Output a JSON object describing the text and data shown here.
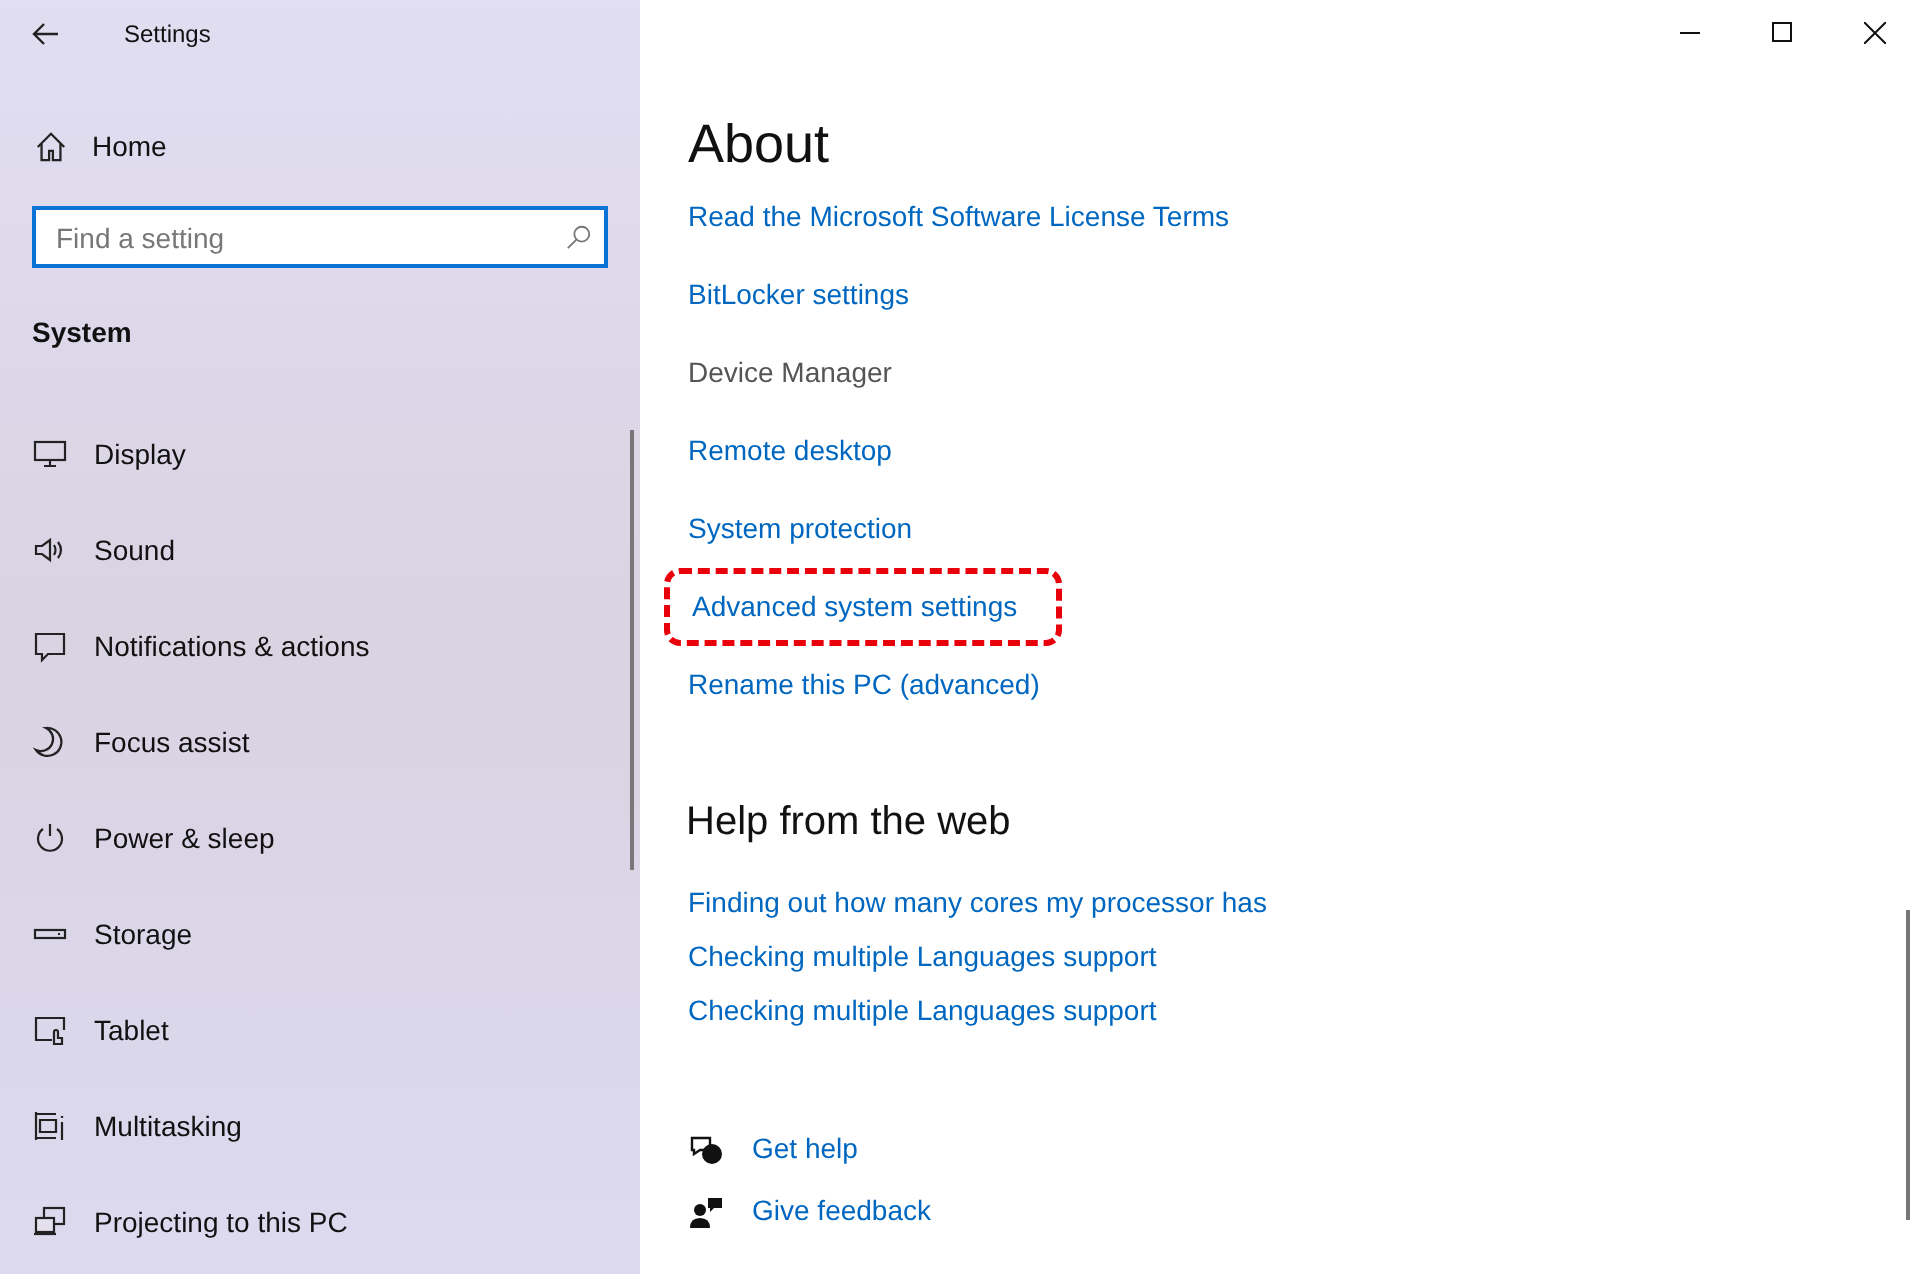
{
  "window": {
    "title": "Settings"
  },
  "sidebar": {
    "home": "Home",
    "search": {
      "placeholder": "Find a setting"
    },
    "section": "System",
    "items": [
      {
        "kind": "display",
        "label": "Display"
      },
      {
        "kind": "sound",
        "label": "Sound"
      },
      {
        "kind": "notifications",
        "label": "Notifications & actions"
      },
      {
        "kind": "focus",
        "label": "Focus assist"
      },
      {
        "kind": "power",
        "label": "Power & sleep"
      },
      {
        "kind": "storage",
        "label": "Storage"
      },
      {
        "kind": "tablet",
        "label": "Tablet"
      },
      {
        "kind": "multitasking",
        "label": "Multitasking"
      },
      {
        "kind": "projecting",
        "label": "Projecting to this PC"
      }
    ]
  },
  "main": {
    "title": "About",
    "links": [
      {
        "label": "Read the Microsoft Software License Terms",
        "disabled": false,
        "highlighted": false
      },
      {
        "label": "BitLocker settings",
        "disabled": false,
        "highlighted": false
      },
      {
        "label": "Device Manager",
        "disabled": true,
        "highlighted": false
      },
      {
        "label": "Remote desktop",
        "disabled": false,
        "highlighted": false
      },
      {
        "label": "System protection",
        "disabled": false,
        "highlighted": false
      },
      {
        "label": "Advanced system settings",
        "disabled": false,
        "highlighted": true
      },
      {
        "label": "Rename this PC (advanced)",
        "disabled": false,
        "highlighted": false
      }
    ],
    "help_title": "Help from the web",
    "help_links": [
      "Finding out how many cores my processor has",
      "Checking multiple Languages support",
      "Checking multiple Languages support"
    ],
    "actions": [
      {
        "kind": "help",
        "label": "Get help"
      },
      {
        "kind": "feedback",
        "label": "Give feedback"
      }
    ]
  }
}
